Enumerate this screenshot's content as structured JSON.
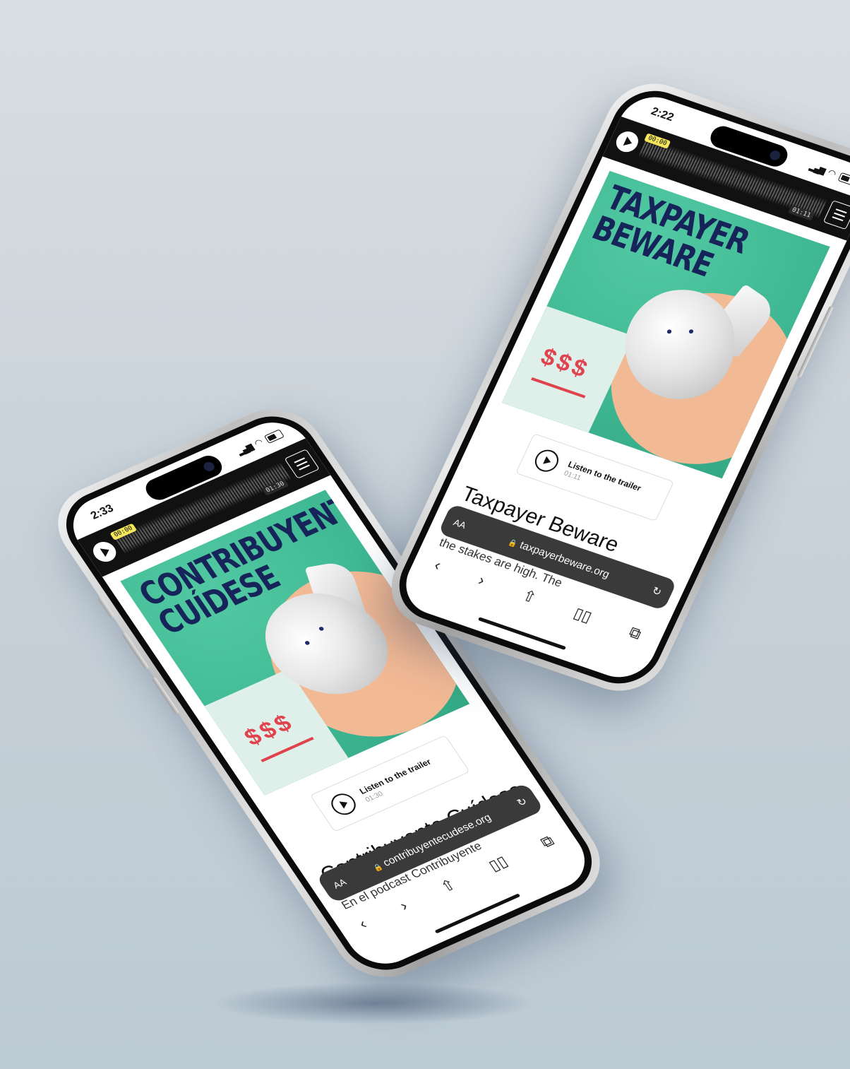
{
  "phones": [
    {
      "id": "spanish",
      "status_time": "2:33",
      "player": {
        "time_start": "00:00",
        "time_end": "01:30"
      },
      "cover_title": "CONTRIBUYENTE CUÍDESE",
      "cover_dollars": "$$$",
      "trailer": {
        "label": "Listen to the trailer",
        "duration": "01:30"
      },
      "title": "Contribuyente Cuídese",
      "description": "En el podcast Contribuyente",
      "url": "contribuyentecudese.org",
      "aa_label": "AA"
    },
    {
      "id": "english",
      "status_time": "2:22",
      "player": {
        "time_start": "00:00",
        "time_end": "01:11"
      },
      "cover_title": "TAXPAYER BEWARE",
      "cover_dollars": "$$$",
      "trailer": {
        "label": "Listen to the trailer",
        "duration": "01:11"
      },
      "title": "Taxpayer Beware",
      "description": "When it comes to selecting a tax preparer, the stakes are high. The",
      "url": "taxpayerbeware.org",
      "aa_label": "AA"
    }
  ],
  "icons": [
    "play-icon",
    "menu-icon",
    "lock-icon",
    "reload-icon",
    "back-icon",
    "forward-icon",
    "share-icon",
    "bookmarks-icon",
    "tabs-icon",
    "bell-icon",
    "signal-icon",
    "wifi-icon",
    "battery-icon"
  ],
  "colors": {
    "cover_green": "#3fb893",
    "title_navy": "#16245a",
    "dollar_red": "#e0434d",
    "peach": "#f2b995",
    "time_badge": "#f3e65a"
  }
}
